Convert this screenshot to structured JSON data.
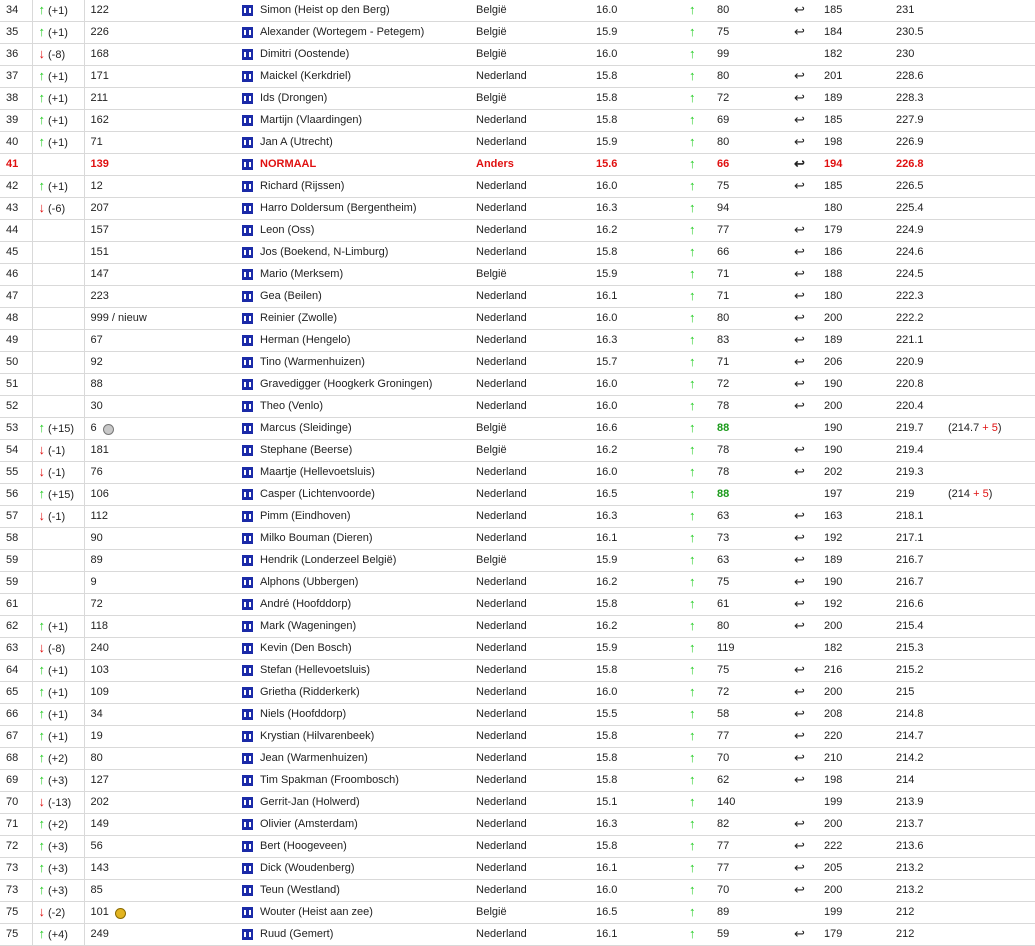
{
  "rows": [
    {
      "rank": "34",
      "dir": "up",
      "change": "(+1)",
      "prev": "122",
      "medal": "",
      "name": "Simon (Heist op den Berg)",
      "country": "België",
      "score": "16.0",
      "num": "80",
      "green": false,
      "turn": true,
      "a": "185",
      "total": "231",
      "bonus": null,
      "highlight": false
    },
    {
      "rank": "35",
      "dir": "up",
      "change": "(+1)",
      "prev": "226",
      "medal": "",
      "name": "Alexander (Wortegem - Petegem)",
      "country": "België",
      "score": "15.9",
      "num": "75",
      "green": false,
      "turn": true,
      "a": "184",
      "total": "230.5",
      "bonus": null,
      "highlight": false
    },
    {
      "rank": "36",
      "dir": "down",
      "change": "(-8)",
      "prev": "168",
      "medal": "",
      "name": "Dimitri (Oostende)",
      "country": "België",
      "score": "16.0",
      "num": "99",
      "green": false,
      "turn": false,
      "a": "182",
      "total": "230",
      "bonus": null,
      "highlight": false
    },
    {
      "rank": "37",
      "dir": "up",
      "change": "(+1)",
      "prev": "171",
      "medal": "",
      "name": "Maickel (Kerkdriel)",
      "country": "Nederland",
      "score": "15.8",
      "num": "80",
      "green": false,
      "turn": true,
      "a": "201",
      "total": "228.6",
      "bonus": null,
      "highlight": false
    },
    {
      "rank": "38",
      "dir": "up",
      "change": "(+1)",
      "prev": "211",
      "medal": "",
      "name": "Ids (Drongen)",
      "country": "België",
      "score": "15.8",
      "num": "72",
      "green": false,
      "turn": true,
      "a": "189",
      "total": "228.3",
      "bonus": null,
      "highlight": false
    },
    {
      "rank": "39",
      "dir": "up",
      "change": "(+1)",
      "prev": "162",
      "medal": "",
      "name": "Martijn (Vlaardingen)",
      "country": "Nederland",
      "score": "15.8",
      "num": "69",
      "green": false,
      "turn": true,
      "a": "185",
      "total": "227.9",
      "bonus": null,
      "highlight": false
    },
    {
      "rank": "40",
      "dir": "up",
      "change": "(+1)",
      "prev": "71",
      "medal": "",
      "name": "Jan A (Utrecht)",
      "country": "Nederland",
      "score": "15.9",
      "num": "80",
      "green": false,
      "turn": true,
      "a": "198",
      "total": "226.9",
      "bonus": null,
      "highlight": false
    },
    {
      "rank": "41",
      "dir": "",
      "change": "",
      "prev": "139",
      "medal": "",
      "name": "NORMAAL",
      "country": "Anders",
      "score": "15.6",
      "num": "66",
      "green": false,
      "turn": true,
      "a": "194",
      "total": "226.8",
      "bonus": null,
      "highlight": true
    },
    {
      "rank": "42",
      "dir": "up",
      "change": "(+1)",
      "prev": "12",
      "medal": "",
      "name": "Richard (Rijssen)",
      "country": "Nederland",
      "score": "16.0",
      "num": "75",
      "green": false,
      "turn": true,
      "a": "185",
      "total": "226.5",
      "bonus": null,
      "highlight": false
    },
    {
      "rank": "43",
      "dir": "down",
      "change": "(-6)",
      "prev": "207",
      "medal": "",
      "name": "Harro Doldersum (Bergentheim)",
      "country": "Nederland",
      "score": "16.3",
      "num": "94",
      "green": false,
      "turn": false,
      "a": "180",
      "total": "225.4",
      "bonus": null,
      "highlight": false
    },
    {
      "rank": "44",
      "dir": "",
      "change": "",
      "prev": "157",
      "medal": "",
      "name": "Leon (Oss)",
      "country": "Nederland",
      "score": "16.2",
      "num": "77",
      "green": false,
      "turn": true,
      "a": "179",
      "total": "224.9",
      "bonus": null,
      "highlight": false
    },
    {
      "rank": "45",
      "dir": "",
      "change": "",
      "prev": "151",
      "medal": "",
      "name": "Jos (Boekend, N-Limburg)",
      "country": "Nederland",
      "score": "15.8",
      "num": "66",
      "green": false,
      "turn": true,
      "a": "186",
      "total": "224.6",
      "bonus": null,
      "highlight": false
    },
    {
      "rank": "46",
      "dir": "",
      "change": "",
      "prev": "147",
      "medal": "",
      "name": "Mario (Merksem)",
      "country": "België",
      "score": "15.9",
      "num": "71",
      "green": false,
      "turn": true,
      "a": "188",
      "total": "224.5",
      "bonus": null,
      "highlight": false
    },
    {
      "rank": "47",
      "dir": "",
      "change": "",
      "prev": "223",
      "medal": "",
      "name": "Gea (Beilen)",
      "country": "Nederland",
      "score": "16.1",
      "num": "71",
      "green": false,
      "turn": true,
      "a": "180",
      "total": "222.3",
      "bonus": null,
      "highlight": false
    },
    {
      "rank": "48",
      "dir": "",
      "change": "",
      "prev": "999 / nieuw",
      "medal": "",
      "name": "Reinier (Zwolle)",
      "country": "Nederland",
      "score": "16.0",
      "num": "80",
      "green": false,
      "turn": true,
      "a": "200",
      "total": "222.2",
      "bonus": null,
      "highlight": false
    },
    {
      "rank": "49",
      "dir": "",
      "change": "",
      "prev": "67",
      "medal": "",
      "name": "Herman (Hengelo)",
      "country": "Nederland",
      "score": "16.3",
      "num": "83",
      "green": false,
      "turn": true,
      "a": "189",
      "total": "221.1",
      "bonus": null,
      "highlight": false
    },
    {
      "rank": "50",
      "dir": "",
      "change": "",
      "prev": "92",
      "medal": "",
      "name": "Tino (Warmenhuizen)",
      "country": "Nederland",
      "score": "15.7",
      "num": "71",
      "green": false,
      "turn": true,
      "a": "206",
      "total": "220.9",
      "bonus": null,
      "highlight": false
    },
    {
      "rank": "51",
      "dir": "",
      "change": "",
      "prev": "88",
      "medal": "",
      "name": "Gravedigger (Hoogkerk Groningen)",
      "country": "Nederland",
      "score": "16.0",
      "num": "72",
      "green": false,
      "turn": true,
      "a": "190",
      "total": "220.8",
      "bonus": null,
      "highlight": false
    },
    {
      "rank": "52",
      "dir": "",
      "change": "",
      "prev": "30",
      "medal": "",
      "name": "Theo (Venlo)",
      "country": "Nederland",
      "score": "16.0",
      "num": "78",
      "green": false,
      "turn": true,
      "a": "200",
      "total": "220.4",
      "bonus": null,
      "highlight": false
    },
    {
      "rank": "53",
      "dir": "up",
      "change": "(+15)",
      "prev": "6",
      "medal": "silver",
      "name": "Marcus (Sleidinge)",
      "country": "België",
      "score": "16.6",
      "num": "88",
      "green": true,
      "turn": false,
      "a": "190",
      "total": "219.7",
      "bonus": {
        "base": "(214.7",
        "plus": "+ 5",
        "close": ")"
      },
      "highlight": false
    },
    {
      "rank": "54",
      "dir": "down",
      "change": "(-1)",
      "prev": "181",
      "medal": "",
      "name": "Stephane (Beerse)",
      "country": "België",
      "score": "16.2",
      "num": "78",
      "green": false,
      "turn": true,
      "a": "190",
      "total": "219.4",
      "bonus": null,
      "highlight": false
    },
    {
      "rank": "55",
      "dir": "down",
      "change": "(-1)",
      "prev": "76",
      "medal": "",
      "name": "Maartje (Hellevoetsluis)",
      "country": "Nederland",
      "score": "16.0",
      "num": "78",
      "green": false,
      "turn": true,
      "a": "202",
      "total": "219.3",
      "bonus": null,
      "highlight": false
    },
    {
      "rank": "56",
      "dir": "up",
      "change": "(+15)",
      "prev": "106",
      "medal": "",
      "name": "Casper (Lichtenvoorde)",
      "country": "Nederland",
      "score": "16.5",
      "num": "88",
      "green": true,
      "turn": false,
      "a": "197",
      "total": "219",
      "bonus": {
        "base": "(214",
        "plus": "+ 5",
        "close": ")"
      },
      "highlight": false
    },
    {
      "rank": "57",
      "dir": "down",
      "change": "(-1)",
      "prev": "112",
      "medal": "",
      "name": "Pimm (Eindhoven)",
      "country": "Nederland",
      "score": "16.3",
      "num": "63",
      "green": false,
      "turn": true,
      "a": "163",
      "total": "218.1",
      "bonus": null,
      "highlight": false
    },
    {
      "rank": "58",
      "dir": "",
      "change": "",
      "prev": "90",
      "medal": "",
      "name": "Milko Bouman (Dieren)",
      "country": "Nederland",
      "score": "16.1",
      "num": "73",
      "green": false,
      "turn": true,
      "a": "192",
      "total": "217.1",
      "bonus": null,
      "highlight": false
    },
    {
      "rank": "59",
      "dir": "",
      "change": "",
      "prev": "89",
      "medal": "",
      "name": "Hendrik (Londerzeel België)",
      "country": "België",
      "score": "15.9",
      "num": "63",
      "green": false,
      "turn": true,
      "a": "189",
      "total": "216.7",
      "bonus": null,
      "highlight": false
    },
    {
      "rank": "59",
      "dir": "",
      "change": "",
      "prev": "9",
      "medal": "",
      "name": "Alphons (Ubbergen)",
      "country": "Nederland",
      "score": "16.2",
      "num": "75",
      "green": false,
      "turn": true,
      "a": "190",
      "total": "216.7",
      "bonus": null,
      "highlight": false
    },
    {
      "rank": "61",
      "dir": "",
      "change": "",
      "prev": "72",
      "medal": "",
      "name": "André (Hoofddorp)",
      "country": "Nederland",
      "score": "15.8",
      "num": "61",
      "green": false,
      "turn": true,
      "a": "192",
      "total": "216.6",
      "bonus": null,
      "highlight": false
    },
    {
      "rank": "62",
      "dir": "up",
      "change": "(+1)",
      "prev": "118",
      "medal": "",
      "name": "Mark (Wageningen)",
      "country": "Nederland",
      "score": "16.2",
      "num": "80",
      "green": false,
      "turn": true,
      "a": "200",
      "total": "215.4",
      "bonus": null,
      "highlight": false
    },
    {
      "rank": "63",
      "dir": "down",
      "change": "(-8)",
      "prev": "240",
      "medal": "",
      "name": "Kevin (Den Bosch)",
      "country": "Nederland",
      "score": "15.9",
      "num": "119",
      "green": false,
      "turn": false,
      "a": "182",
      "total": "215.3",
      "bonus": null,
      "highlight": false
    },
    {
      "rank": "64",
      "dir": "up",
      "change": "(+1)",
      "prev": "103",
      "medal": "",
      "name": "Stefan (Hellevoetsluis)",
      "country": "Nederland",
      "score": "15.8",
      "num": "75",
      "green": false,
      "turn": true,
      "a": "216",
      "total": "215.2",
      "bonus": null,
      "highlight": false
    },
    {
      "rank": "65",
      "dir": "up",
      "change": "(+1)",
      "prev": "109",
      "medal": "",
      "name": "Grietha (Ridderkerk)",
      "country": "Nederland",
      "score": "16.0",
      "num": "72",
      "green": false,
      "turn": true,
      "a": "200",
      "total": "215",
      "bonus": null,
      "highlight": false
    },
    {
      "rank": "66",
      "dir": "up",
      "change": "(+1)",
      "prev": "34",
      "medal": "",
      "name": "Niels (Hoofddorp)",
      "country": "Nederland",
      "score": "15.5",
      "num": "58",
      "green": false,
      "turn": true,
      "a": "208",
      "total": "214.8",
      "bonus": null,
      "highlight": false
    },
    {
      "rank": "67",
      "dir": "up",
      "change": "(+1)",
      "prev": "19",
      "medal": "",
      "name": "Krystian (Hilvarenbeek)",
      "country": "Nederland",
      "score": "15.8",
      "num": "77",
      "green": false,
      "turn": true,
      "a": "220",
      "total": "214.7",
      "bonus": null,
      "highlight": false
    },
    {
      "rank": "68",
      "dir": "up",
      "change": "(+2)",
      "prev": "80",
      "medal": "",
      "name": "Jean (Warmenhuizen)",
      "country": "Nederland",
      "score": "15.8",
      "num": "70",
      "green": false,
      "turn": true,
      "a": "210",
      "total": "214.2",
      "bonus": null,
      "highlight": false
    },
    {
      "rank": "69",
      "dir": "up",
      "change": "(+3)",
      "prev": "127",
      "medal": "",
      "name": "Tim Spakman (Froombosch)",
      "country": "Nederland",
      "score": "15.8",
      "num": "62",
      "green": false,
      "turn": true,
      "a": "198",
      "total": "214",
      "bonus": null,
      "highlight": false
    },
    {
      "rank": "70",
      "dir": "down",
      "change": "(-13)",
      "prev": "202",
      "medal": "",
      "name": "Gerrit-Jan (Holwerd)",
      "country": "Nederland",
      "score": "15.1",
      "num": "140",
      "green": false,
      "turn": false,
      "a": "199",
      "total": "213.9",
      "bonus": null,
      "highlight": false
    },
    {
      "rank": "71",
      "dir": "up",
      "change": "(+2)",
      "prev": "149",
      "medal": "",
      "name": "Olivier (Amsterdam)",
      "country": "Nederland",
      "score": "16.3",
      "num": "82",
      "green": false,
      "turn": true,
      "a": "200",
      "total": "213.7",
      "bonus": null,
      "highlight": false
    },
    {
      "rank": "72",
      "dir": "up",
      "change": "(+3)",
      "prev": "56",
      "medal": "",
      "name": "Bert (Hoogeveen)",
      "country": "Nederland",
      "score": "15.8",
      "num": "77",
      "green": false,
      "turn": true,
      "a": "222",
      "total": "213.6",
      "bonus": null,
      "highlight": false
    },
    {
      "rank": "73",
      "dir": "up",
      "change": "(+3)",
      "prev": "143",
      "medal": "",
      "name": "Dick (Woudenberg)",
      "country": "Nederland",
      "score": "16.1",
      "num": "77",
      "green": false,
      "turn": true,
      "a": "205",
      "total": "213.2",
      "bonus": null,
      "highlight": false
    },
    {
      "rank": "73",
      "dir": "up",
      "change": "(+3)",
      "prev": "85",
      "medal": "",
      "name": "Teun (Westland)",
      "country": "Nederland",
      "score": "16.0",
      "num": "70",
      "green": false,
      "turn": true,
      "a": "200",
      "total": "213.2",
      "bonus": null,
      "highlight": false
    },
    {
      "rank": "75",
      "dir": "down",
      "change": "(-2)",
      "prev": "101",
      "medal": "gold",
      "name": "Wouter (Heist aan zee)",
      "country": "België",
      "score": "16.5",
      "num": "89",
      "green": false,
      "turn": false,
      "a": "199",
      "total": "212",
      "bonus": null,
      "highlight": false
    },
    {
      "rank": "75",
      "dir": "up",
      "change": "(+4)",
      "prev": "249",
      "medal": "",
      "name": "Ruud (Gemert)",
      "country": "Nederland",
      "score": "16.1",
      "num": "59",
      "green": false,
      "turn": true,
      "a": "179",
      "total": "212",
      "bonus": null,
      "highlight": false
    }
  ],
  "icons": {
    "up_arrow": "up-arrow-icon",
    "down_arrow": "down-arrow-icon",
    "turn_arrow": "return-arrow-icon",
    "profile": "profile-icon",
    "medal": "medal-icon"
  },
  "colors": {
    "up": "#22cc22",
    "down": "#e01010",
    "highlight": "#e01010",
    "green_value": "#1a9a1a",
    "flag": "#1a2aa8"
  }
}
